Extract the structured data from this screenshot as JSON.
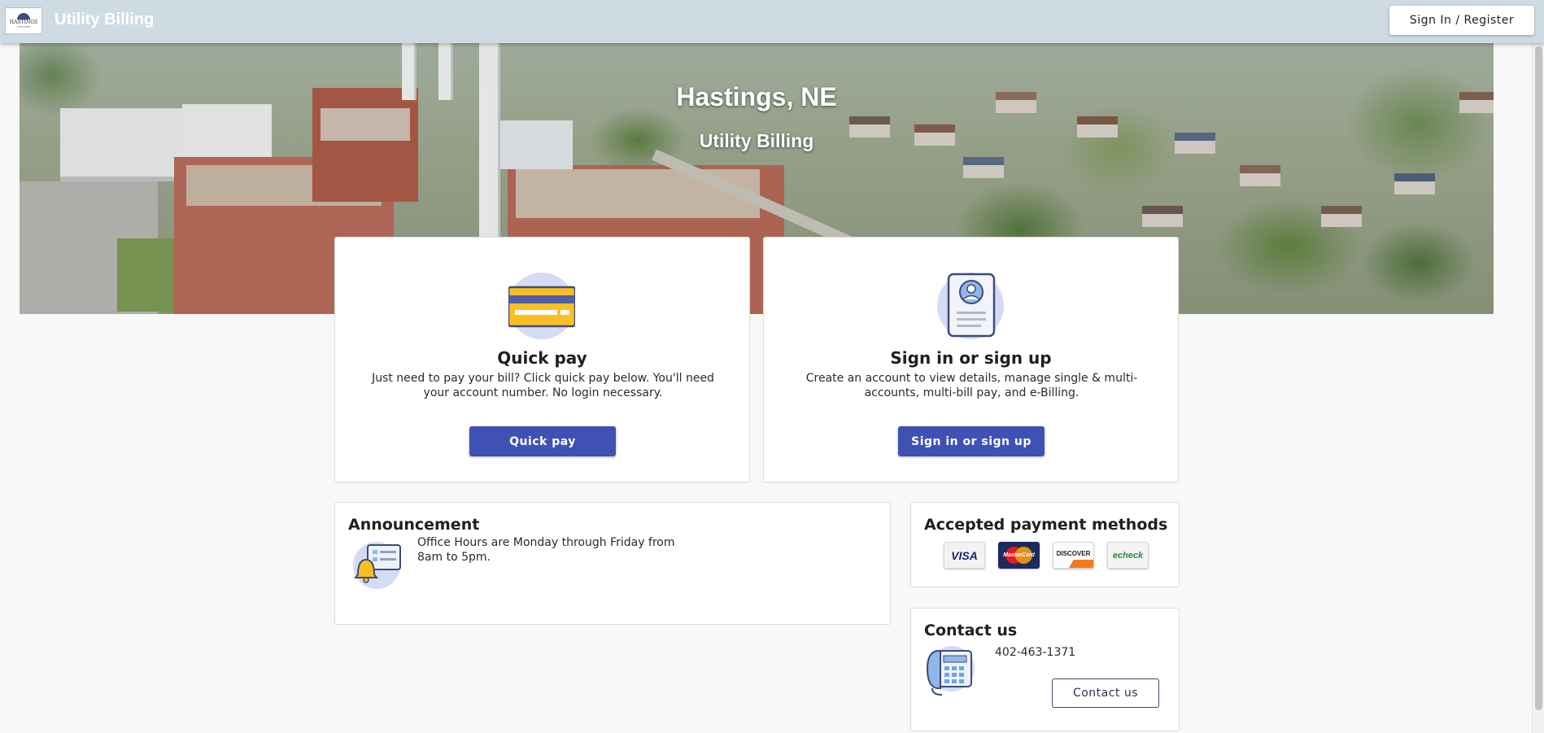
{
  "header": {
    "logo_text": "HASTINGS",
    "logo_subtext": "UTILITIES",
    "title": "Utility Billing",
    "signin_label": "Sign In / Register"
  },
  "hero": {
    "title": "Hastings, NE",
    "subtitle": "Utility Billing"
  },
  "quick_pay": {
    "heading": "Quick pay",
    "description": "Just need to pay your bill? Click quick pay below. You'll need your account number. No login necessary.",
    "button_label": "Quick pay",
    "icon": "credit-card-icon"
  },
  "sign_up": {
    "heading": "Sign in or sign up",
    "description": "Create an account to view details, manage single & multi-accounts, multi-bill pay, and e-Billing.",
    "button_label": "Sign in or sign up",
    "icon": "profile-document-icon"
  },
  "announcement": {
    "title": "Announcement",
    "text": "Office Hours are Monday through Friday from 8am to 5pm.",
    "icon": "bell-notification-icon"
  },
  "payment_methods": {
    "title": "Accepted payment methods",
    "methods": [
      {
        "name": "visa",
        "label": "VISA"
      },
      {
        "name": "mastercard",
        "label": "MasterCard"
      },
      {
        "name": "discover",
        "label": "DISCOVER"
      },
      {
        "name": "echeck",
        "label": "echeck"
      }
    ]
  },
  "contact": {
    "title": "Contact us",
    "phone": "402-463-1371",
    "button_label": "Contact us",
    "icon": "telephone-icon"
  },
  "colors": {
    "topbar": "#cfdbe2",
    "primary": "#3f51b5",
    "icon_circle": "#d4dcf5",
    "background": "#f8f8f8"
  }
}
